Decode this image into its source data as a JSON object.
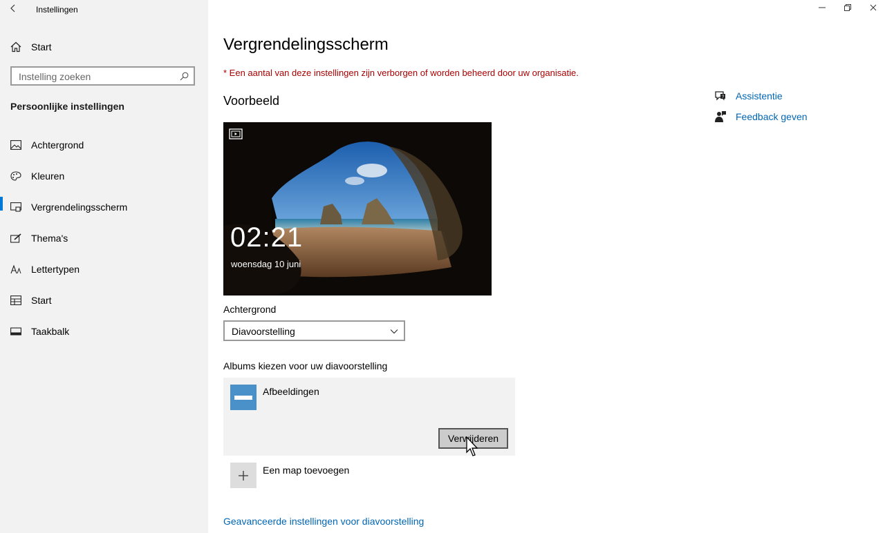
{
  "window": {
    "title": "Instellingen"
  },
  "sidebar": {
    "home_label": "Start",
    "search_placeholder": "Instelling zoeken",
    "section_title": "Persoonlijke instellingen",
    "items": [
      {
        "label": "Achtergrond",
        "icon": "picture-icon"
      },
      {
        "label": "Kleuren",
        "icon": "palette-icon"
      },
      {
        "label": "Vergrendelingsscherm",
        "icon": "lock-screen-icon",
        "active": true
      },
      {
        "label": "Thema's",
        "icon": "theme-brush-icon"
      },
      {
        "label": "Lettertypen",
        "icon": "font-icon"
      },
      {
        "label": "Start",
        "icon": "start-menu-icon"
      },
      {
        "label": "Taakbalk",
        "icon": "taskbar-icon"
      }
    ]
  },
  "main": {
    "title": "Vergrendelingsscherm",
    "org_notice": "* Een aantal van deze instellingen zijn verborgen of worden beheerd door uw organisatie.",
    "preview_heading": "Voorbeeld",
    "preview": {
      "time": "02:21",
      "date": "woensdag 10 juni"
    },
    "background_label": "Achtergrond",
    "background_value": "Diavoorstelling",
    "albums_label": "Albums kiezen voor uw diavoorstelling",
    "album_name": "Afbeeldingen",
    "remove_button": "Verwijderen",
    "add_folder": "Een map toevoegen",
    "advanced_link": "Geavanceerde instellingen voor diavoorstelling"
  },
  "help": {
    "assist": "Assistentie",
    "feedback": "Feedback geven"
  },
  "colors": {
    "accent": "#0078d7",
    "link": "#0066b4",
    "warning": "#a80000"
  }
}
